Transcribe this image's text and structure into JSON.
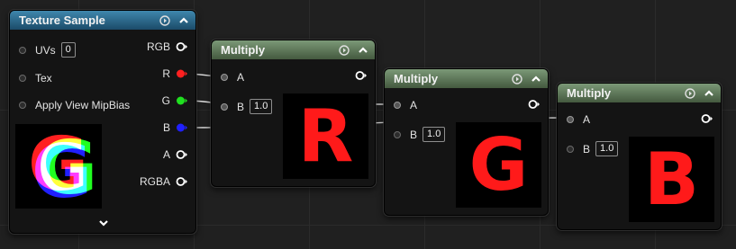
{
  "texture_sample": {
    "title": "Texture Sample",
    "inputs": [
      {
        "label": "UVs",
        "value": "0"
      },
      {
        "label": "Tex"
      },
      {
        "label": "Apply View MipBias"
      }
    ],
    "outputs": [
      {
        "label": "RGB",
        "color": "#ffffff"
      },
      {
        "label": "R",
        "color": "#ff2020"
      },
      {
        "label": "G",
        "color": "#20e020"
      },
      {
        "label": "B",
        "color": "#2020ff"
      },
      {
        "label": "A",
        "color": "#ffffff"
      },
      {
        "label": "RGBA",
        "color": "#ffffff"
      }
    ],
    "preview_letter": "G",
    "header_color": "#2e6f93"
  },
  "multiply_nodes": [
    {
      "title": "Multiply",
      "input_a": "A",
      "input_b": "B",
      "b_value": "1.0",
      "preview_letter": "R",
      "b_connected": true
    },
    {
      "title": "Multiply",
      "input_a": "A",
      "input_b": "B",
      "b_value": "1.0",
      "preview_letter": "G",
      "b_connected": false
    },
    {
      "title": "Multiply",
      "input_a": "A",
      "input_b": "B",
      "b_value": "1.0",
      "preview_letter": "B",
      "b_connected": false
    }
  ],
  "icons": {
    "preview_toggle": "play-circle-icon",
    "collapse": "chevron-up-icon",
    "expand": "chevron-down-icon",
    "output_pin": "output-pin-icon"
  },
  "colors": {
    "header_green": "#56704f",
    "header_blue": "#2e6f93",
    "wire": "#e6e6e6",
    "preview_letter": "#ff1a1a"
  }
}
